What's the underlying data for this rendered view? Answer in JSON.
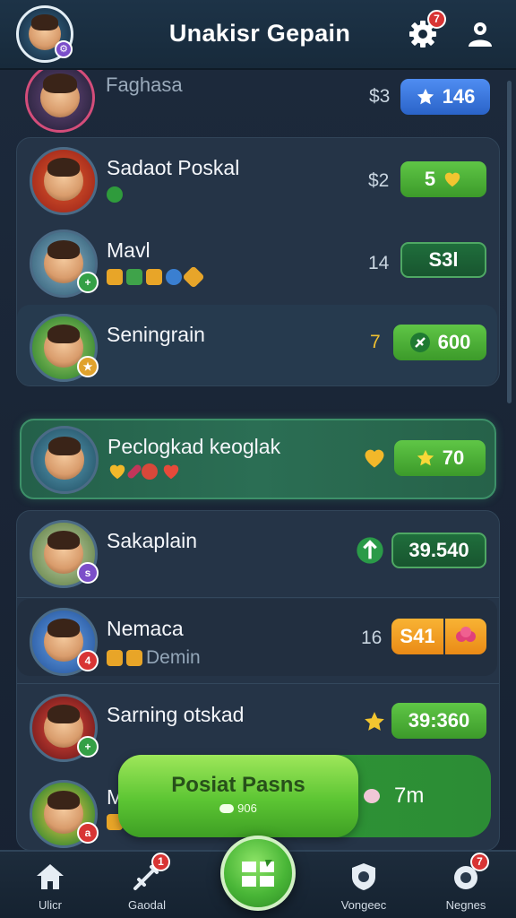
{
  "header": {
    "title": "Unakisr Gepain",
    "settings_badge": "7"
  },
  "rows": [
    {
      "name": "Faghasa",
      "sub": "",
      "num": "$3",
      "pill": "146"
    },
    {
      "name": "Sadaot Poskal",
      "sub": "",
      "num": "$2",
      "pill": "5"
    },
    {
      "name": "Mavl",
      "sub": "",
      "num": "14",
      "pill": "S3l"
    },
    {
      "name": "Seningrain",
      "sub": "",
      "num": "7",
      "pill": "600"
    },
    {
      "name": "Peclogkad keoglak",
      "sub": "",
      "num": "",
      "pill": "70"
    },
    {
      "name": "Sakaplain",
      "sub": "",
      "num": "",
      "pill": "39.540"
    },
    {
      "name": "Nemaca",
      "sub": "Demin",
      "num": "16",
      "pill": "S41"
    },
    {
      "name": "Sarning otskad",
      "sub": "",
      "num": "",
      "pill": "39:360"
    },
    {
      "name": "M",
      "sub": "",
      "num": "",
      "pill": ""
    }
  ],
  "banner": {
    "title": "Posiat Pasns",
    "subtitle": "906",
    "right_text": "7m"
  },
  "nav": [
    {
      "label": "Ulicr",
      "badge": ""
    },
    {
      "label": "Gaodal",
      "badge": "1"
    },
    {
      "label": "Vongeec",
      "badge": ""
    },
    {
      "label": "Negnes",
      "badge": "7"
    }
  ],
  "colors": {
    "accent_green": "#49b637",
    "badge_red": "#d83434",
    "header_bg": "#172a3b"
  }
}
